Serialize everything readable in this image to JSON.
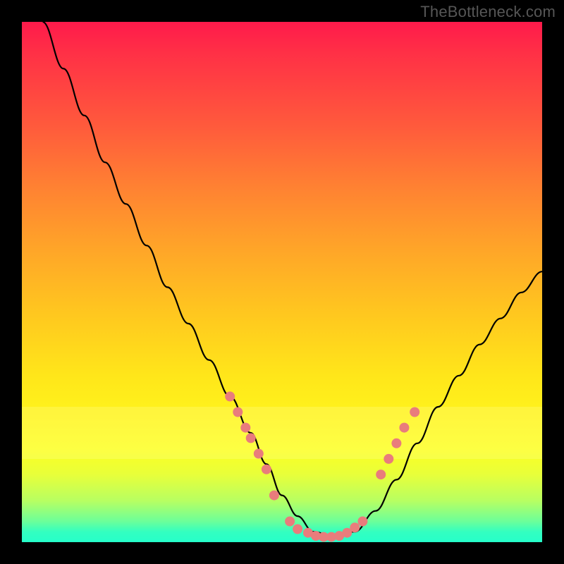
{
  "watermark": "TheBottleneck.com",
  "chart_data": {
    "type": "line",
    "title": "",
    "xlabel": "",
    "ylabel": "",
    "xlim": [
      0,
      100
    ],
    "ylim": [
      0,
      100
    ],
    "series": [
      {
        "name": "bottleneck-curve",
        "x": [
          4,
          8,
          12,
          16,
          20,
          24,
          28,
          32,
          36,
          40,
          44,
          47,
          50,
          53,
          56,
          60,
          64,
          68,
          72,
          76,
          80,
          84,
          88,
          92,
          96,
          100
        ],
        "y": [
          100,
          91,
          82,
          73,
          65,
          57,
          49,
          42,
          35,
          28,
          21,
          15,
          9,
          5,
          2,
          1,
          2,
          6,
          12,
          19,
          26,
          32,
          38,
          43,
          48,
          52
        ],
        "color": "#000000"
      }
    ],
    "markers": [
      {
        "name": "left-cluster",
        "points": [
          {
            "x": 40,
            "y": 28
          },
          {
            "x": 41.5,
            "y": 25
          },
          {
            "x": 43,
            "y": 22
          },
          {
            "x": 44,
            "y": 20
          },
          {
            "x": 45.5,
            "y": 17
          },
          {
            "x": 47,
            "y": 14
          },
          {
            "x": 48.5,
            "y": 9
          }
        ],
        "color": "#e97c7c"
      },
      {
        "name": "bottom-cluster",
        "points": [
          {
            "x": 51.5,
            "y": 4
          },
          {
            "x": 53,
            "y": 2.5
          },
          {
            "x": 55,
            "y": 1.8
          },
          {
            "x": 56.5,
            "y": 1.2
          },
          {
            "x": 58,
            "y": 1
          },
          {
            "x": 59.5,
            "y": 1
          },
          {
            "x": 61,
            "y": 1.2
          },
          {
            "x": 62.5,
            "y": 1.8
          },
          {
            "x": 64,
            "y": 2.8
          },
          {
            "x": 65.5,
            "y": 4
          }
        ],
        "color": "#e97c7c"
      },
      {
        "name": "right-cluster",
        "points": [
          {
            "x": 69,
            "y": 13
          },
          {
            "x": 70.5,
            "y": 16
          },
          {
            "x": 72,
            "y": 19
          },
          {
            "x": 73.5,
            "y": 22
          },
          {
            "x": 75.5,
            "y": 25
          }
        ],
        "color": "#e97c7c"
      }
    ],
    "highlight_band": {
      "ymin": 16,
      "ymax": 26,
      "color": "rgba(255,255,180,0.22)"
    }
  }
}
